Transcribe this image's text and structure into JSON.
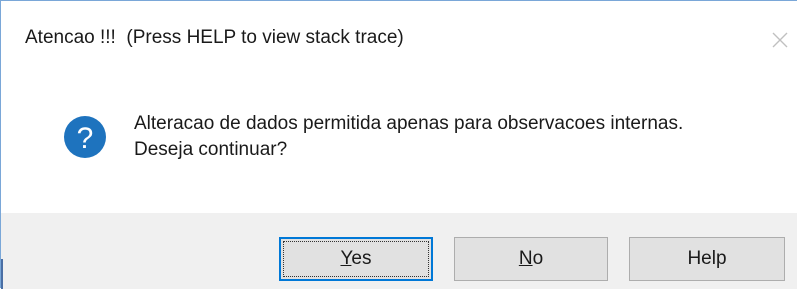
{
  "dialog": {
    "title": "Atencao !!!  (Press HELP to view stack trace)",
    "icon": "question-icon",
    "message_line1": "Alteracao de dados permitida apenas para observacoes internas.",
    "message_line2": "Deseja continuar?"
  },
  "buttons": {
    "yes": {
      "accel": "Y",
      "rest": "es"
    },
    "no": {
      "accel": "N",
      "rest": "o"
    },
    "help": {
      "label": "Help"
    }
  },
  "colors": {
    "icon_blue": "#1e73be",
    "default_button_border": "#0078d7",
    "footer_bg": "#f0f0f0",
    "button_bg": "#e1e1e1"
  }
}
